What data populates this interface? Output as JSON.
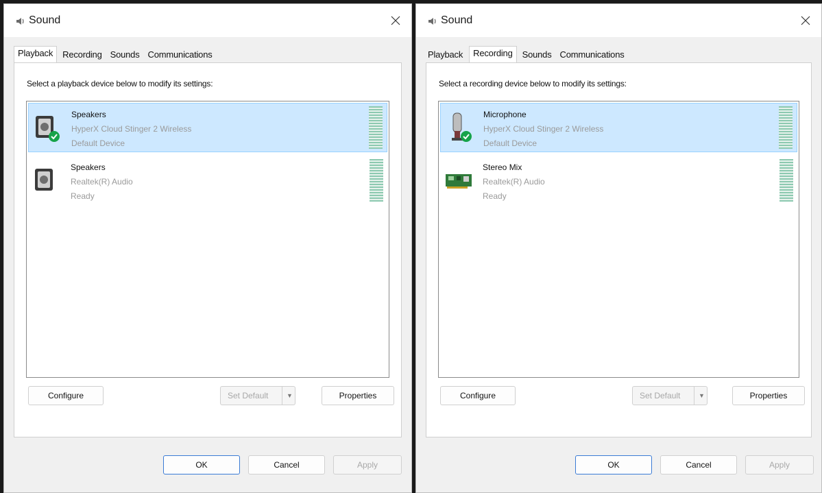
{
  "colors": {
    "selection": "#cde8ff",
    "selection_border": "#99d1ff",
    "level_meter": "#8cc9b0",
    "check_green": "#16a34a"
  },
  "left": {
    "title": "Sound",
    "tabs": [
      "Playback",
      "Recording",
      "Sounds",
      "Communications"
    ],
    "active_tab": "Playback",
    "instruction": "Select a playback device below to modify its settings:",
    "devices": [
      {
        "name": "Speakers",
        "detail": "HyperX Cloud Stinger 2 Wireless",
        "status": "Default Device",
        "icon": "speaker-icon",
        "selected": true
      },
      {
        "name": "Speakers",
        "detail": "Realtek(R) Audio",
        "status": "Ready",
        "icon": "speaker-icon",
        "selected": false
      }
    ],
    "buttons": {
      "configure": "Configure",
      "set_default": "Set Default",
      "properties": "Properties",
      "ok": "OK",
      "cancel": "Cancel",
      "apply": "Apply"
    }
  },
  "right": {
    "title": "Sound",
    "tabs": [
      "Playback",
      "Recording",
      "Sounds",
      "Communications"
    ],
    "active_tab": "Recording",
    "instruction": "Select a recording device below to modify its settings:",
    "devices": [
      {
        "name": "Microphone",
        "detail": "HyperX Cloud Stinger 2 Wireless",
        "status": "Default Device",
        "icon": "microphone-icon",
        "selected": true
      },
      {
        "name": "Stereo Mix",
        "detail": "Realtek(R) Audio",
        "status": "Ready",
        "icon": "sound-card-icon",
        "selected": false
      }
    ],
    "buttons": {
      "configure": "Configure",
      "set_default": "Set Default",
      "properties": "Properties",
      "ok": "OK",
      "cancel": "Cancel",
      "apply": "Apply"
    }
  }
}
